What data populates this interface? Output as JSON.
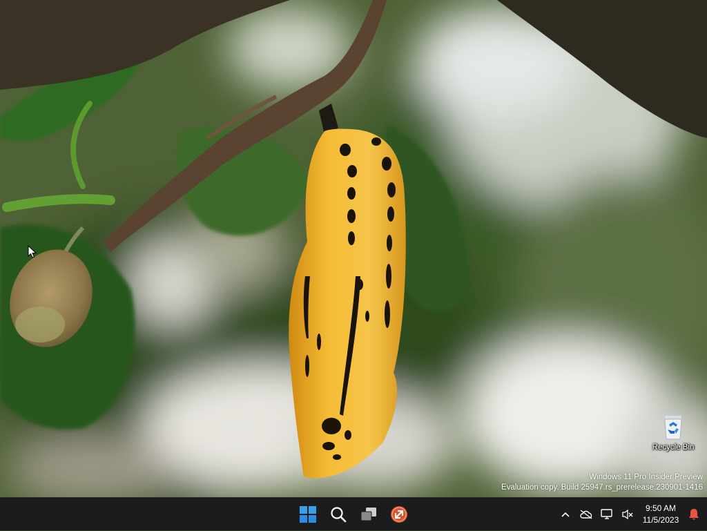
{
  "desktop": {
    "icons": [
      {
        "label": "Recycle Bin",
        "icon": "recycle-bin-icon"
      }
    ],
    "watermark": {
      "line1": "Windows 11 Pro Insider Preview",
      "line2": "Evaluation copy. Build 25947.rs_prerelease.230901-1416"
    }
  },
  "taskbar": {
    "apps": [
      {
        "name": "start",
        "icon": "windows-logo-icon"
      },
      {
        "name": "search",
        "icon": "search-icon"
      },
      {
        "name": "task-view",
        "icon": "task-view-icon"
      },
      {
        "name": "remote-desktop",
        "icon": "remote-desktop-icon"
      }
    ],
    "tray": {
      "icons": [
        "chevron-up-icon",
        "cloud-off-icon",
        "network-icon",
        "volume-muted-icon"
      ],
      "time": "9:50 AM",
      "date": "11/5/2023",
      "notification_icon": "bell-icon",
      "notification_color": "#e8553f"
    }
  },
  "colors": {
    "taskbar_bg": "#1c1c1c",
    "windows_blue": "#3aa0ea",
    "chrysalis": "#f2b531"
  }
}
